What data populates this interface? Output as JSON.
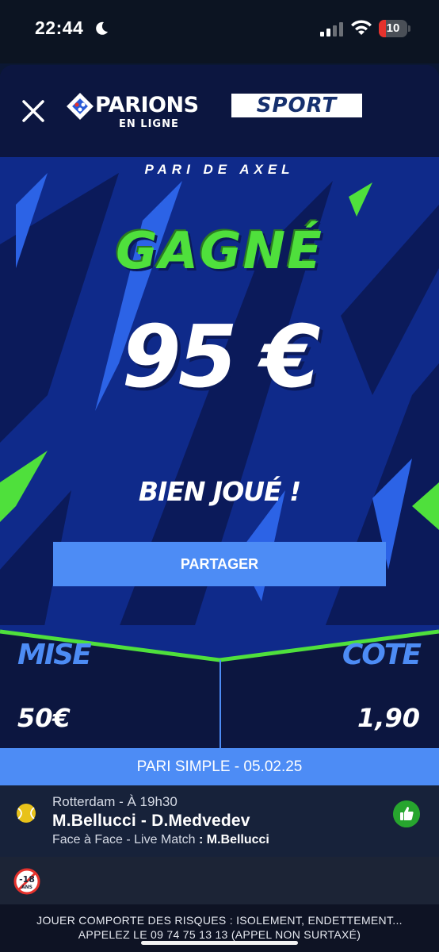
{
  "status_bar": {
    "time": "22:44",
    "battery": "10",
    "icons": [
      "moon-icon",
      "signal-icon",
      "wifi-icon",
      "battery-icon"
    ],
    "battery_color": "#e5322d"
  },
  "header": {
    "logo_main": "PARIONS",
    "logo_sport": "SPORT",
    "logo_sub": "EN LIGNE"
  },
  "hero": {
    "bettor": "PARI DE AXEL",
    "result": "GAGNÉ",
    "winnings": "95 €",
    "congrats": "BIEN JOUÉ !",
    "share_label": "PARTAGER"
  },
  "bet": {
    "stake_label": "MISE",
    "stake_value": "50€",
    "odds_label": "COTE",
    "odds_value": "1,90",
    "type_line": "PARI SIMPLE - 05.02.25"
  },
  "match": {
    "meta": "Rotterdam - À 19h30",
    "name": "M.Bellucci - D.Medvedev",
    "market": "Face à Face - Live Match",
    "selection": ": M.Bellucci"
  },
  "legal": {
    "age_badge": "-18 ANS",
    "line1": "JOUER COMPORTE DES RISQUES : ISOLEMENT, ENDETTEMENT...",
    "line2": "APPELEZ LE 09 74 75 13 13 (APPEL NON SURTAXÉ)"
  },
  "colors": {
    "accent_blue": "#4d8cf5",
    "win_green": "#4fe03c",
    "navy": "#0c1640"
  }
}
